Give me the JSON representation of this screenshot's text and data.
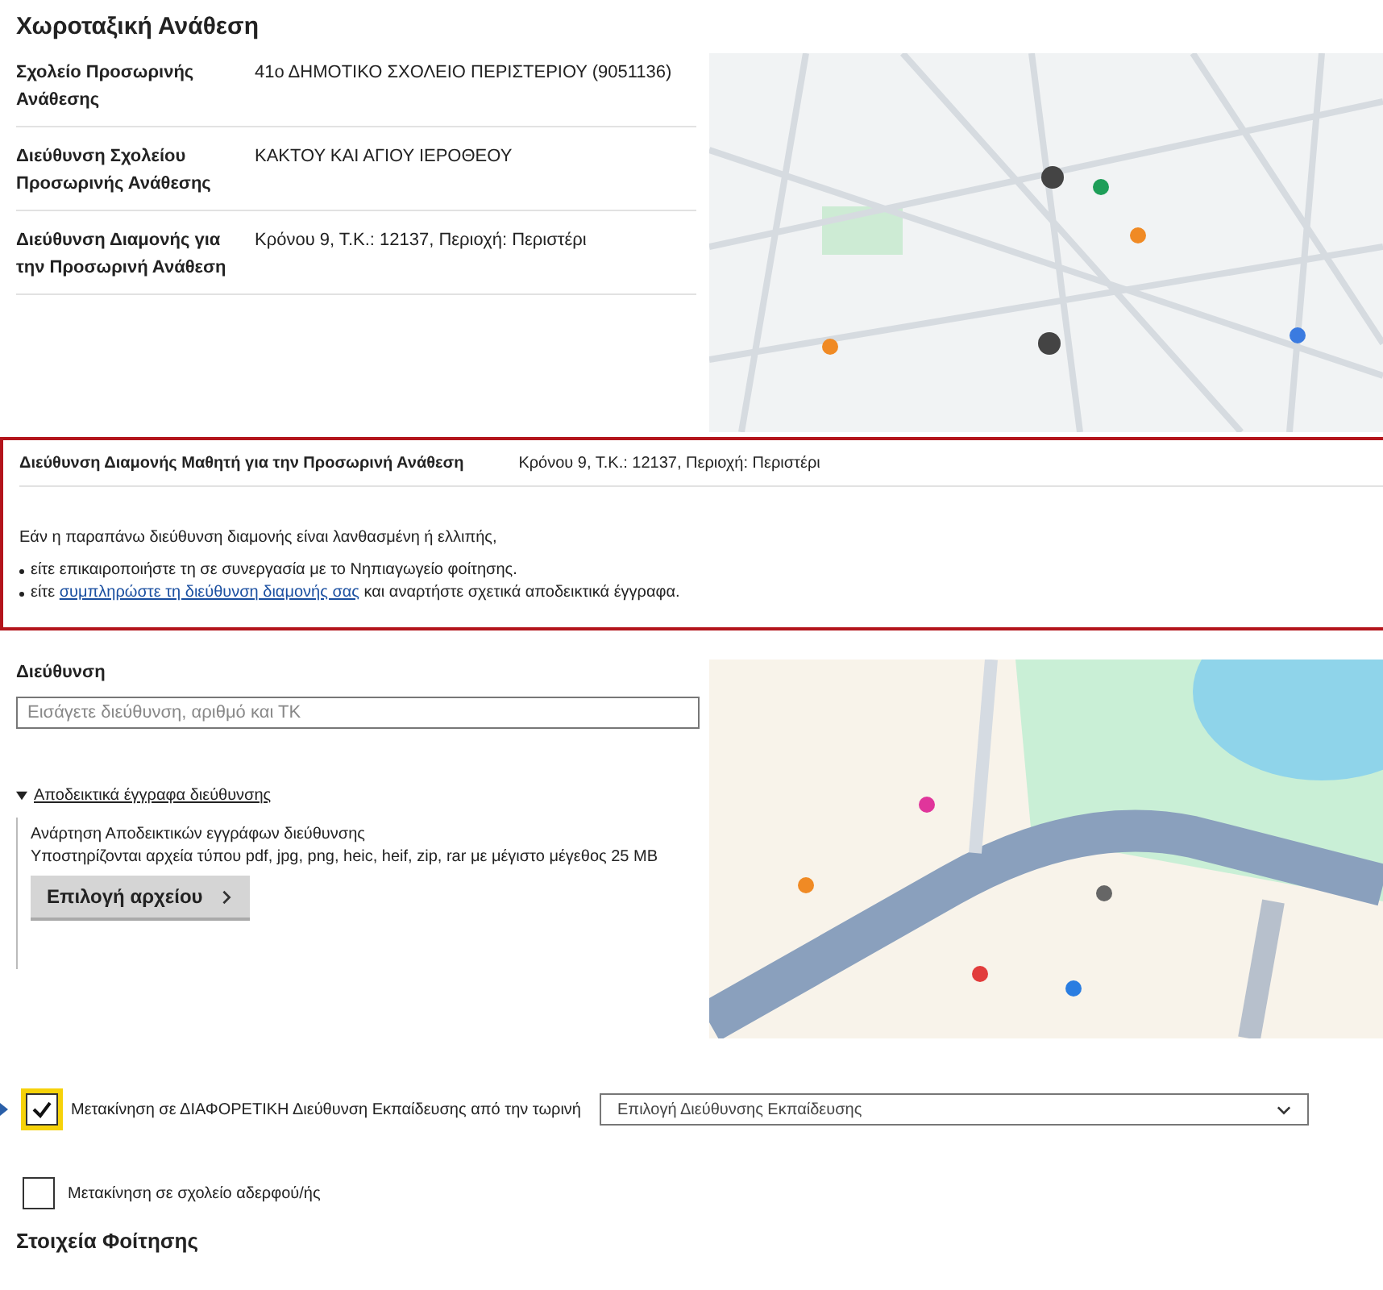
{
  "title": "Χωροταξική Ανάθεση",
  "info_rows": [
    {
      "label": "Σχολείο Προσωρινής Ανάθεσης",
      "value": "41ο ΔΗΜΟΤΙΚΟ ΣΧΟΛΕΙΟ ΠΕΡΙΣΤΕΡΙΟΥ (9051136)"
    },
    {
      "label": "Διεύθυνση Σχολείου Προσωρινής Ανάθεσης",
      "value": "ΚΑΚΤΟΥ ΚΑΙ ΑΓΙΟΥ ΙΕΡΟΘΕΟΥ"
    },
    {
      "label": "Διεύθυνση Διαμονής για την Προσωρινή Ανάθεση",
      "value": "Κρόνου 9, Τ.Κ.: 12137, Περιοχή: Περιστέρι"
    }
  ],
  "notice": {
    "label": "Διεύθυνση Διαμονής Μαθητή για την Προσωρινή Ανάθεση",
    "value": "Κρόνου 9, Τ.Κ.: 12137, Περιοχή: Περιστέρι",
    "intro": "Εάν η παραπάνω διεύθυνση διαμονής είναι λανθασμένη ή ελλιπής,",
    "bullets": [
      {
        "before": "είτε επικαιροποιήστε τη σε συνεργασία με το Νηπιαγωγείο φοίτησης."
      },
      {
        "before": "είτε ",
        "link": "συμπληρώστε τη διεύθυνση διαμονής σας",
        "after": " και αναρτήστε σχετικά αποδεικτικά έγγραφα."
      }
    ]
  },
  "address": {
    "label": "Διεύθυνση",
    "placeholder": "Εισάγετε διεύθυνση, αριθμό και ΤΚ"
  },
  "documents": {
    "toggle": "Αποδεικτικά έγγραφα διεύθυνσης",
    "expanded": true,
    "upload_title": "Ανάρτηση Αποδεικτικών εγγράφων διεύθυνσης",
    "upload_hint": "Υποστηρίζονται αρχεία τύπου pdf, jpg, png, heic, heif, zip, rar με μέγιστο μέγεθος 25 MB",
    "button": "Επιλογή αρχείου"
  },
  "options": [
    {
      "label": "Μετακίνηση σε ΔΙΑΦΟΡΕΤΙΚΗ Διεύθυνση Εκπαίδευσης από την τωρινή",
      "checked": true,
      "focused": true,
      "select_placeholder": "Επιλογή Διεύθυνσης Εκπαίδευσης"
    },
    {
      "label": "Μετακίνηση σε σχολείο αδερφού/ής",
      "checked": false,
      "focused": false
    }
  ],
  "section_heading": "Στοιχεία Φοίτησης"
}
